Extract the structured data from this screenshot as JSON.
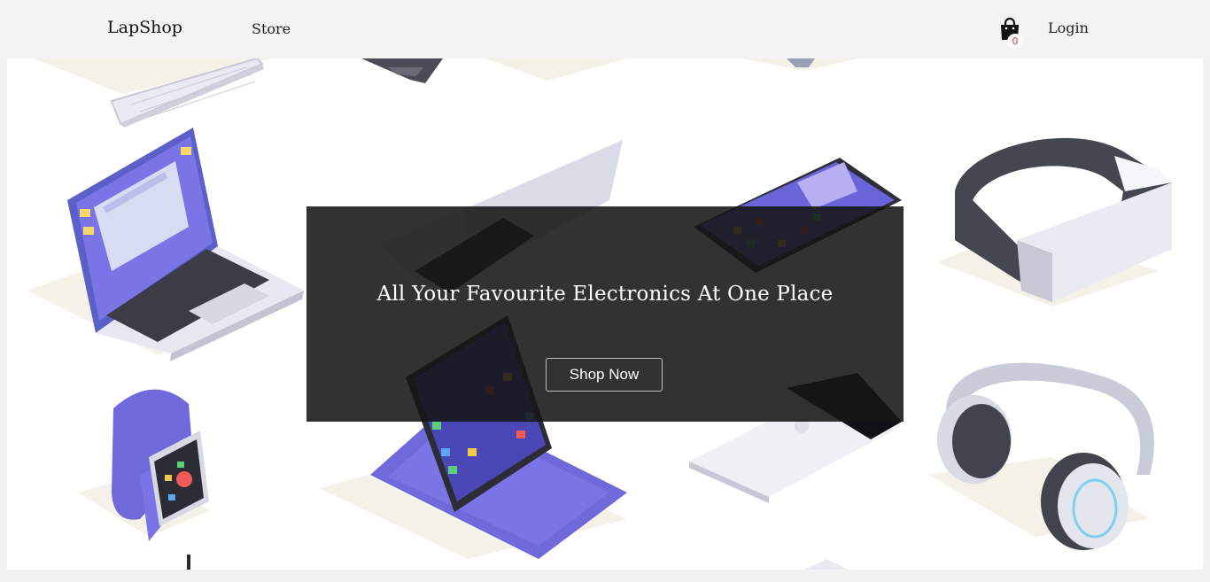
{
  "navbar": {
    "brand": "LapShop",
    "store_label": "Store",
    "cart_count": "0",
    "login_label": "Login"
  },
  "hero": {
    "headline": "All Your Favourite Electronics At One Place",
    "cta_label": "Shop Now"
  },
  "icons": {
    "cart": "shopping-bag-icon"
  },
  "colors": {
    "accent_purple": "#7b73e6",
    "navbar_bg": "#f3f3f3",
    "overlay_bg": "#161616",
    "badge_text": "#d33333"
  }
}
